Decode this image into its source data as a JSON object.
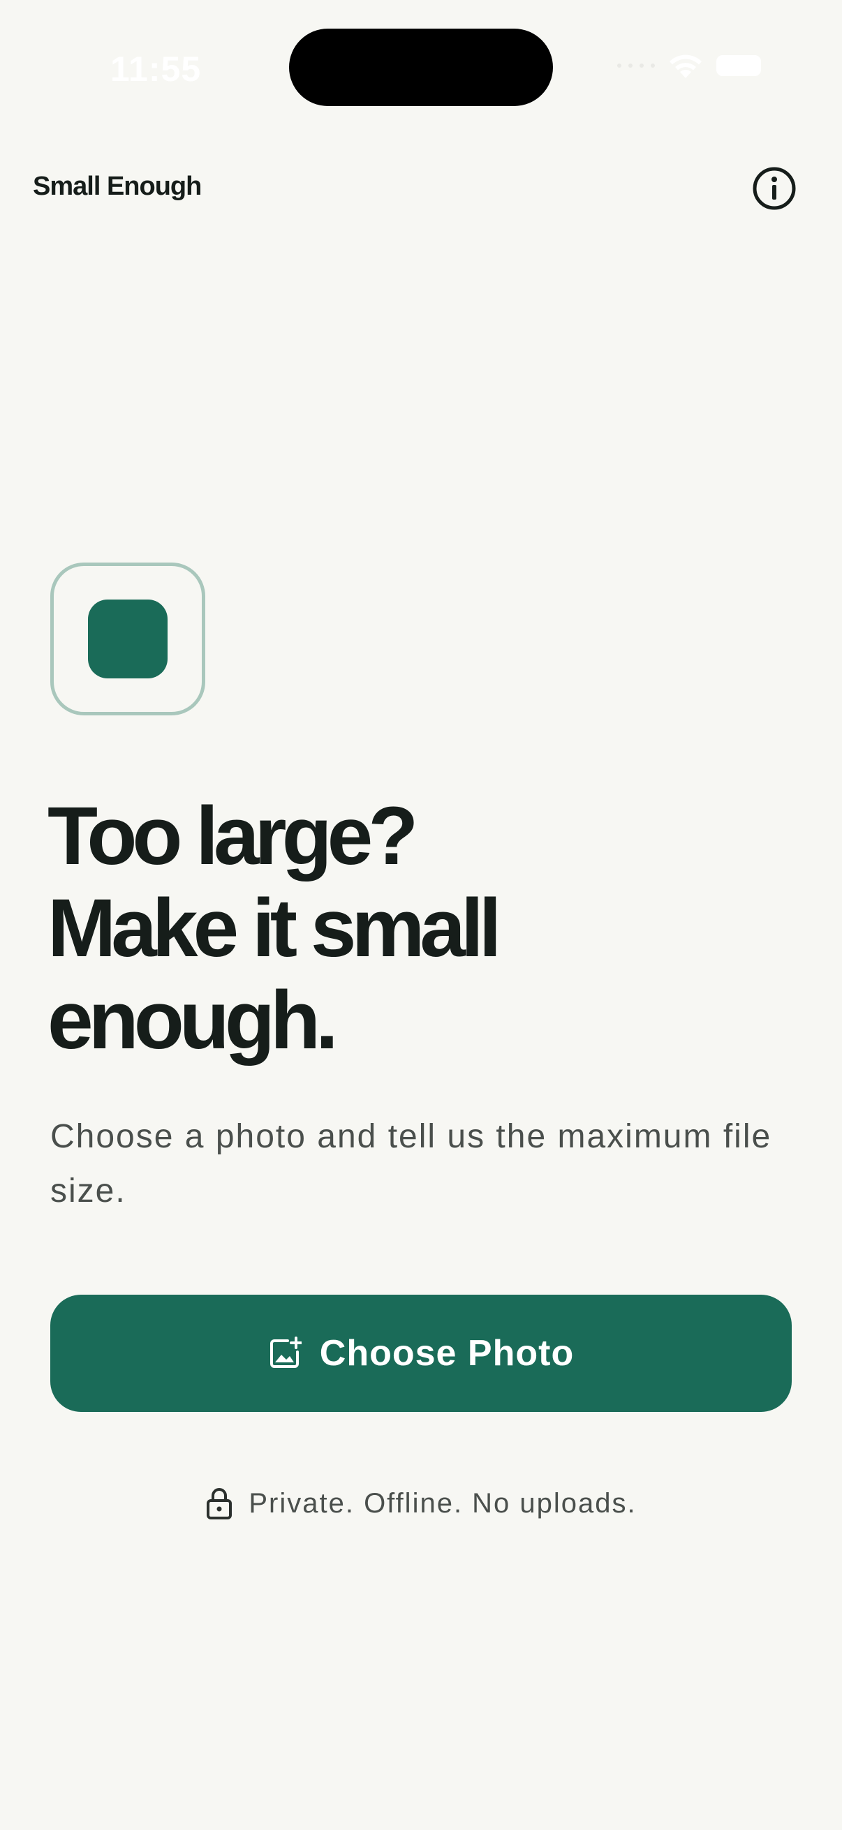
{
  "status_bar": {
    "time": "11:55"
  },
  "header": {
    "title": "Small Enough",
    "info_icon": "info-circle-icon"
  },
  "hero": {
    "headline_lines": [
      "Too large?",
      "Make it small",
      "enough."
    ],
    "subtitle": "Choose a photo and tell us the maximum file size."
  },
  "actions": {
    "choose_photo_label": "Choose Photo",
    "choose_photo_icon": "photo-add-icon"
  },
  "privacy": {
    "icon": "lock-icon",
    "text": "Private. Offline. No uploads."
  },
  "colors": {
    "background": "#f7f7f3",
    "accent": "#1a6b58",
    "logo_border": "#a9c7bc",
    "text_primary": "#161d1a",
    "text_secondary": "#4a4f4c"
  }
}
